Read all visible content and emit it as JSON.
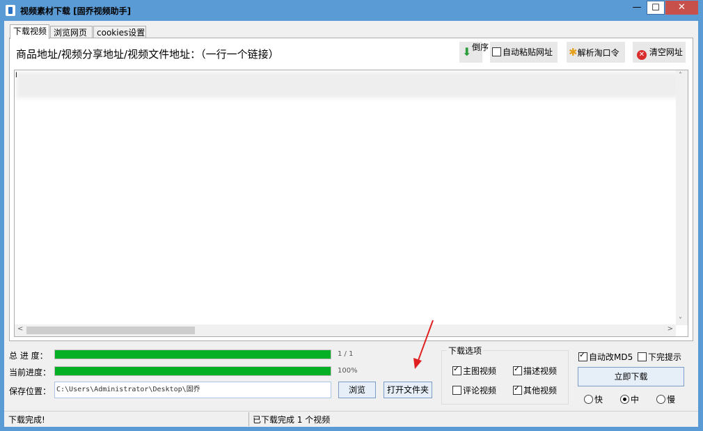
{
  "window": {
    "title": "视频素材下载 [固乔视频助手]",
    "min_label": "—",
    "max_label": "☐",
    "close_label": "✕"
  },
  "tabs": [
    {
      "label": "下载视频",
      "active": true
    },
    {
      "label": "浏览网页",
      "active": false
    },
    {
      "label": "cookies设置",
      "active": false
    }
  ],
  "toolbar": {
    "instruction": "商品地址/视频分享地址/视频文件地址：（一行一个链接）",
    "reverse_label": "倒序",
    "auto_paste_label": "自动粘贴网址",
    "auto_paste_checked": false,
    "parse_label": "解析淘口令",
    "clear_label": "清空网址"
  },
  "url_input": {
    "value": "l"
  },
  "progress": {
    "total_label": "总 进 度：",
    "total_text": "1 / 1",
    "total_fraction": 1.0,
    "current_label": "当前进度：",
    "current_text": "100%",
    "current_fraction": 1.0
  },
  "save": {
    "label": "保存位置：",
    "path": "C:\\Users\\Administrator\\Desktop\\固乔",
    "browse_label": "浏览",
    "open_folder_label": "打开文件夹"
  },
  "download_options": {
    "title": "下载选项",
    "items": [
      {
        "label": "主图视频",
        "checked": true
      },
      {
        "label": "描述视频",
        "checked": true
      },
      {
        "label": "评论视频",
        "checked": false
      },
      {
        "label": "其他视频",
        "checked": true
      }
    ]
  },
  "right_options": {
    "auto_md5_label": "自动改MD5",
    "auto_md5_checked": true,
    "finish_tip_label": "下完提示",
    "finish_tip_checked": false,
    "download_now_label": "立即下载",
    "speed": [
      {
        "label": "快",
        "selected": false
      },
      {
        "label": "中",
        "selected": true
      },
      {
        "label": "慢",
        "selected": false
      }
    ]
  },
  "status": {
    "left": "下载完成!",
    "right": "已下载完成 1 个视频"
  },
  "colors": {
    "titlebar": "#5b9bd5",
    "progress_fill": "#06b025",
    "close_button": "#c7504a",
    "annotation_arrow": "#e02020"
  }
}
